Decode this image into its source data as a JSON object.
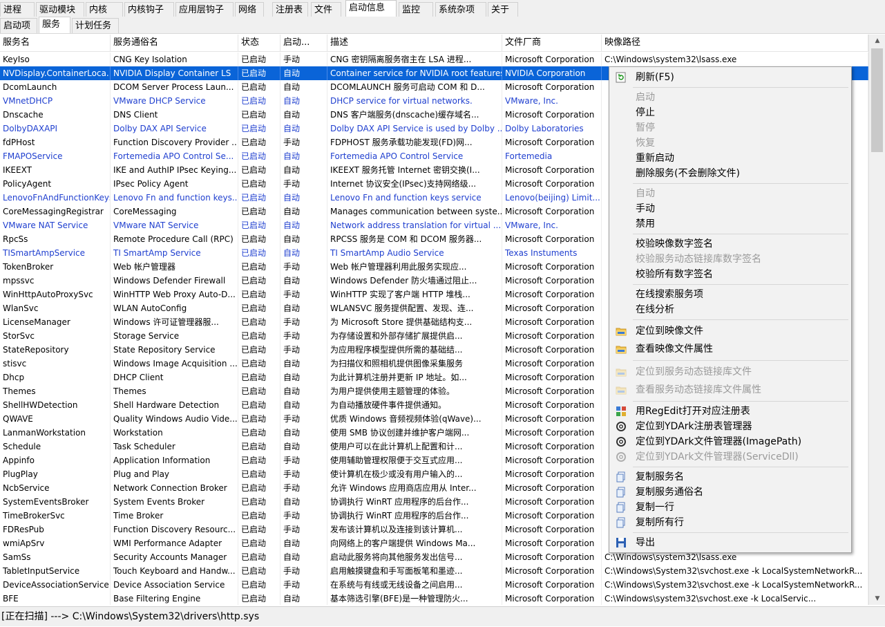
{
  "tabs_top": [
    "进程",
    "驱动模块",
    "内核",
    "内核钩子",
    "应用层钩子",
    "网络",
    "注册表",
    "文件",
    "启动信息",
    "监控",
    "系统杂项",
    "关于"
  ],
  "tabs_top_active": "启动信息",
  "tabs_sub": [
    "启动项",
    "服务",
    "计划任务"
  ],
  "tabs_sub_active": "服务",
  "columns": [
    "服务名",
    "服务通俗名",
    "状态",
    "启动...",
    "描述",
    "文件厂商",
    "映像路径"
  ],
  "rows": [
    [
      "KeyIso",
      "CNG Key Isolation",
      "已启动",
      "手动",
      "CNG 密钥隔离服务宿主在 LSA 进程...",
      "Microsoft Corporation",
      "C:\\Windows\\system32\\lsass.exe"
    ],
    [
      "NVDisplay.ContainerLoca...",
      "NVIDIA Display Container LS",
      "已启动",
      "自动",
      "Container service for NVIDIA root features",
      "NVIDIA Corporation",
      ""
    ],
    [
      "DcomLaunch",
      "DCOM Server Process Laun...",
      "已启动",
      "自动",
      "DCOMLAUNCH 服务可启动 COM 和 D...",
      "Microsoft Corporation",
      ""
    ],
    [
      "VMnetDHCP",
      "VMware DHCP Service",
      "已启动",
      "自动",
      "DHCP service for virtual networks.",
      "VMware, Inc.",
      ""
    ],
    [
      "Dnscache",
      "DNS Client",
      "已启动",
      "自动",
      "DNS 客户端服务(dnscache)缓存域名...",
      "Microsoft Corporation",
      ""
    ],
    [
      "DolbyDAXAPI",
      "Dolby DAX API Service",
      "已启动",
      "自动",
      "Dolby DAX API Service is used by Dolby ...",
      "Dolby Laboratories",
      ""
    ],
    [
      "fdPHost",
      "Function Discovery Provider ...",
      "已启动",
      "手动",
      "FDPHOST 服务承载功能发现(FD)网...",
      "Microsoft Corporation",
      ""
    ],
    [
      "FMAPOService",
      "Fortemedia APO Control Se...",
      "已启动",
      "自动",
      "Fortemedia APO Control Service",
      "Fortemedia",
      ""
    ],
    [
      "IKEEXT",
      "IKE and AuthIP IPsec Keying...",
      "已启动",
      "自动",
      "IKEEXT 服务托管 Internet 密钥交换(I...",
      "Microsoft Corporation",
      ""
    ],
    [
      "PolicyAgent",
      "IPsec Policy Agent",
      "已启动",
      "手动",
      "Internet 协议安全(IPsec)支持网络级...",
      "Microsoft Corporation",
      ""
    ],
    [
      "LenovoFnAndFunctionKeys",
      "Lenovo Fn and function keys...",
      "已启动",
      "自动",
      "Lenovo Fn and function keys service",
      "Lenovo(beijing) Limit...",
      ""
    ],
    [
      "CoreMessagingRegistrar",
      "CoreMessaging",
      "已启动",
      "自动",
      "Manages communication between syste...",
      "Microsoft Corporation",
      ""
    ],
    [
      "VMware NAT Service",
      "VMware NAT Service",
      "已启动",
      "自动",
      "Network address translation for virtual ...",
      "VMware, Inc.",
      ""
    ],
    [
      "RpcSs",
      "Remote Procedure Call (RPC)",
      "已启动",
      "自动",
      "RPCSS 服务是 COM 和 DCOM 服务器...",
      "Microsoft Corporation",
      ""
    ],
    [
      "TISmartAmpService",
      "TI SmartAmp Service",
      "已启动",
      "自动",
      "TI SmartAmp Audio Service",
      "Texas Instuments",
      ""
    ],
    [
      "TokenBroker",
      "Web 帐户管理器",
      "已启动",
      "手动",
      "Web 帐户管理器利用此服务实现应...",
      "Microsoft Corporation",
      ""
    ],
    [
      "mpssvc",
      "Windows Defender Firewall",
      "已启动",
      "自动",
      "Windows Defender 防火墙通过阻止...",
      "Microsoft Corporation",
      ""
    ],
    [
      "WinHttpAutoProxySvc",
      "WinHTTP Web Proxy Auto-D...",
      "已启动",
      "手动",
      "WinHTTP 实现了客户端 HTTP 堆栈...",
      "Microsoft Corporation",
      ""
    ],
    [
      "WlanSvc",
      "WLAN AutoConfig",
      "已启动",
      "自动",
      "WLANSVC 服务提供配置、发现、连...",
      "Microsoft Corporation",
      ""
    ],
    [
      "LicenseManager",
      "Windows 许可证管理器服...",
      "已启动",
      "手动",
      "为 Microsoft Store 提供基础结构支...",
      "Microsoft Corporation",
      ""
    ],
    [
      "StorSvc",
      "Storage Service",
      "已启动",
      "手动",
      "为存储设置和外部存储扩展提供启...",
      "Microsoft Corporation",
      ""
    ],
    [
      "StateRepository",
      "State Repository Service",
      "已启动",
      "手动",
      "为应用程序模型提供所需的基础结...",
      "Microsoft Corporation",
      ""
    ],
    [
      "stisvc",
      "Windows Image Acquisition ...",
      "已启动",
      "自动",
      "为扫描仪和照相机提供图像采集服务",
      "Microsoft Corporation",
      ""
    ],
    [
      "Dhcp",
      "DHCP Client",
      "已启动",
      "自动",
      "为此计算机注册并更新 IP 地址。如...",
      "Microsoft Corporation",
      ""
    ],
    [
      "Themes",
      "Themes",
      "已启动",
      "自动",
      "为用户提供使用主题管理的体验。",
      "Microsoft Corporation",
      ""
    ],
    [
      "ShellHWDetection",
      "Shell Hardware Detection",
      "已启动",
      "自动",
      "为自动播放硬件事件提供通知。",
      "Microsoft Corporation",
      ""
    ],
    [
      "QWAVE",
      "Quality Windows Audio Vide...",
      "已启动",
      "手动",
      "优质 Windows 音频视频体验(qWave)...",
      "Microsoft Corporation",
      ""
    ],
    [
      "LanmanWorkstation",
      "Workstation",
      "已启动",
      "自动",
      "使用 SMB 协议创建并维护客户端网...",
      "Microsoft Corporation",
      ""
    ],
    [
      "Schedule",
      "Task Scheduler",
      "已启动",
      "自动",
      "使用户可以在此计算机上配置和计...",
      "Microsoft Corporation",
      ""
    ],
    [
      "Appinfo",
      "Application Information",
      "已启动",
      "手动",
      "使用辅助管理权限便于交互式应用...",
      "Microsoft Corporation",
      ""
    ],
    [
      "PlugPlay",
      "Plug and Play",
      "已启动",
      "手动",
      "使计算机在极少或没有用户输入的...",
      "Microsoft Corporation",
      ""
    ],
    [
      "NcbService",
      "Network Connection Broker",
      "已启动",
      "手动",
      "允许 Windows 应用商店应用从 Inter...",
      "Microsoft Corporation",
      ""
    ],
    [
      "SystemEventsBroker",
      "System Events Broker",
      "已启动",
      "自动",
      "协调执行 WinRT 应用程序的后台作...",
      "Microsoft Corporation",
      ""
    ],
    [
      "TimeBrokerSvc",
      "Time Broker",
      "已启动",
      "手动",
      "协调执行 WinRT 应用程序的后台作...",
      "Microsoft Corporation",
      ""
    ],
    [
      "FDResPub",
      "Function Discovery Resourc...",
      "已启动",
      "手动",
      "发布该计算机以及连接到该计算机...",
      "Microsoft Corporation",
      ""
    ],
    [
      "wmiApSrv",
      "WMI Performance Adapter",
      "已启动",
      "自动",
      "向网络上的客户端提供 Windows Ma...",
      "Microsoft Corporation",
      ""
    ],
    [
      "SamSs",
      "Security Accounts Manager",
      "已启动",
      "自动",
      "启动此服务将向其他服务发出信号...",
      "Microsoft Corporation",
      "C:\\Windows\\system32\\lsass.exe"
    ],
    [
      "TabletInputService",
      "Touch Keyboard and Handw...",
      "已启动",
      "手动",
      "启用触摸键盘和手写面板笔和墨迹...",
      "Microsoft Corporation",
      "C:\\Windows\\System32\\svchost.exe -k LocalSystemNetworkR..."
    ],
    [
      "DeviceAssociationService",
      "Device Association Service",
      "已启动",
      "手动",
      "在系统与有线或无线设备之间启用...",
      "Microsoft Corporation",
      "C:\\Windows\\System32\\svchost.exe -k LocalSystemNetworkR..."
    ],
    [
      "BFE",
      "Base Filtering Engine",
      "已启动",
      "自动",
      "基本筛选引擎(BFE)是一种管理防火...",
      "Microsoft Corporation",
      "C:\\Windows\\system32\\svchost.exe -k LocalServic..."
    ]
  ],
  "menu": [
    {
      "type": "item",
      "label": "刷新(F5)",
      "icon": "refresh-icon",
      "enabled": true
    },
    {
      "type": "sep"
    },
    {
      "type": "item",
      "label": "启动",
      "icon": "",
      "enabled": false
    },
    {
      "type": "item",
      "label": "停止",
      "icon": "",
      "enabled": true
    },
    {
      "type": "item",
      "label": "暂停",
      "icon": "",
      "enabled": false
    },
    {
      "type": "item",
      "label": "恢复",
      "icon": "",
      "enabled": false
    },
    {
      "type": "item",
      "label": "重新启动",
      "icon": "",
      "enabled": true
    },
    {
      "type": "item",
      "label": "删除服务(不会删除文件)",
      "icon": "",
      "enabled": true
    },
    {
      "type": "sep"
    },
    {
      "type": "item",
      "label": "自动",
      "icon": "",
      "enabled": false
    },
    {
      "type": "item",
      "label": "手动",
      "icon": "",
      "enabled": true
    },
    {
      "type": "item",
      "label": "禁用",
      "icon": "",
      "enabled": true
    },
    {
      "type": "sep"
    },
    {
      "type": "item",
      "label": "校验映像数字签名",
      "icon": "",
      "enabled": true
    },
    {
      "type": "item",
      "label": "校验服务动态链接库数字签名",
      "icon": "",
      "enabled": false
    },
    {
      "type": "item",
      "label": "校验所有数字签名",
      "icon": "",
      "enabled": true
    },
    {
      "type": "sep"
    },
    {
      "type": "item",
      "label": "在线搜索服务项",
      "icon": "",
      "enabled": true
    },
    {
      "type": "item",
      "label": "在线分析",
      "icon": "",
      "enabled": true
    },
    {
      "type": "sep"
    },
    {
      "type": "item",
      "label": "定位到映像文件",
      "icon": "folder-icon",
      "enabled": true
    },
    {
      "type": "item",
      "label": "查看映像文件属性",
      "icon": "folder-icon",
      "enabled": true
    },
    {
      "type": "sep"
    },
    {
      "type": "item",
      "label": "定位到服务动态链接库文件",
      "icon": "folder-icon",
      "enabled": false
    },
    {
      "type": "item",
      "label": "查看服务动态链接库文件属性",
      "icon": "folder-icon",
      "enabled": false
    },
    {
      "type": "sep"
    },
    {
      "type": "item",
      "label": "用RegEdit打开对应注册表",
      "icon": "regedit-icon",
      "enabled": true
    },
    {
      "type": "item",
      "label": "定位到YDArk注册表管理器",
      "icon": "gear-icon",
      "enabled": true
    },
    {
      "type": "item",
      "label": "定位到YDArk文件管理器(ImagePath)",
      "icon": "gear-icon",
      "enabled": true
    },
    {
      "type": "item",
      "label": "定位到YDArk文件管理器(ServiceDll)",
      "icon": "gear-icon",
      "enabled": false
    },
    {
      "type": "sep"
    },
    {
      "type": "item",
      "label": "复制服务名",
      "icon": "copy-icon",
      "enabled": true
    },
    {
      "type": "item",
      "label": "复制服务通俗名",
      "icon": "copy-icon",
      "enabled": true
    },
    {
      "type": "item",
      "label": "复制一行",
      "icon": "copy-icon",
      "enabled": true
    },
    {
      "type": "item",
      "label": "复制所有行",
      "icon": "copy-icon",
      "enabled": true
    },
    {
      "type": "sep"
    },
    {
      "type": "item",
      "label": "导出",
      "icon": "save-icon",
      "enabled": true
    }
  ],
  "status_text": "[正在扫描] ---> C:\\Windows\\System32\\drivers\\http.sys",
  "colors": {
    "selection": "#0a64d8",
    "third_party_text": "#1f3fcf",
    "menu_bg": "#f2f2f2"
  }
}
